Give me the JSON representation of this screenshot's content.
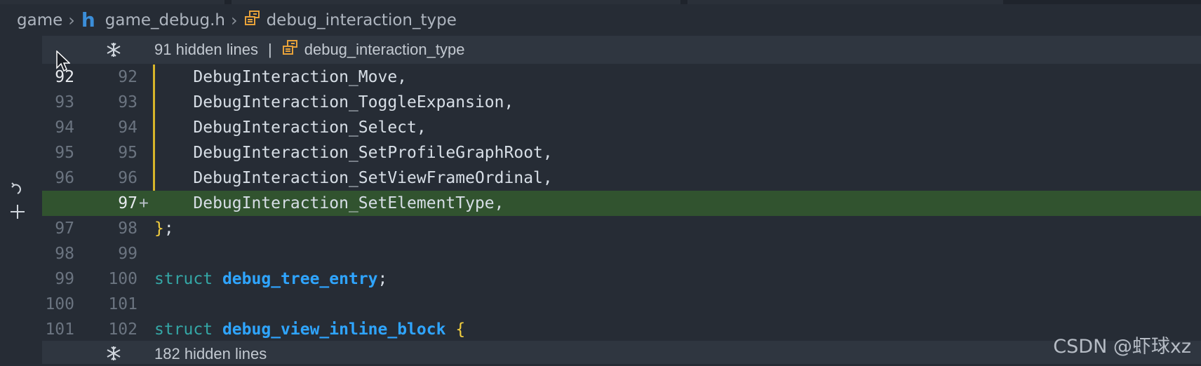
{
  "breadcrumb": {
    "root": "game",
    "file_icon": "h",
    "file": "game_debug.h",
    "symbol": "debug_interaction_type"
  },
  "hidden_top": {
    "count_label": "91 hidden lines",
    "separator": "|",
    "symbol": "debug_interaction_type"
  },
  "hidden_bottom": {
    "count_label": "182 hidden lines"
  },
  "code_lines": [
    {
      "old": "92",
      "new": "92",
      "text": "    DebugInteraction_Move,"
    },
    {
      "old": "93",
      "new": "93",
      "text": "    DebugInteraction_ToggleExpansion,"
    },
    {
      "old": "94",
      "new": "94",
      "text": "    DebugInteraction_Select,"
    },
    {
      "old": "95",
      "new": "95",
      "text": "    DebugInteraction_SetProfileGraphRoot,"
    },
    {
      "old": "96",
      "new": "96",
      "text": "    DebugInteraction_SetViewFrameOrdinal,"
    },
    {
      "old": "",
      "new": "97",
      "marker": "+",
      "text": "    DebugInteraction_SetElementType,"
    },
    {
      "old": "97",
      "new": "98",
      "brace": "}",
      "text": ";"
    },
    {
      "old": "98",
      "new": "99",
      "text": ""
    },
    {
      "old": "99",
      "new": "100",
      "keyword": "struct",
      "type_name": "debug_tree_entry",
      "text": ";"
    },
    {
      "old": "100",
      "new": "101",
      "text": ""
    },
    {
      "old": "101",
      "new": "102",
      "keyword": "struct",
      "type_name": "debug_view_inline_block",
      "brace": "{"
    }
  ],
  "watermark": "CSDN @虾球xz",
  "colors": {
    "added_bg": "#31532f",
    "change_bar": "#d7b52a",
    "keyword": "#34a7a6",
    "type": "#2fa5ff",
    "brace": "#f4d03f"
  }
}
